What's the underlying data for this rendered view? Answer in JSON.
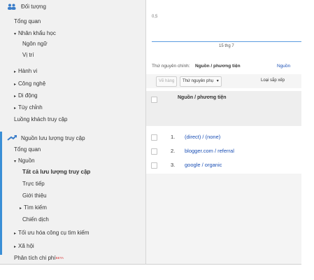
{
  "sidebar": {
    "sections": [
      {
        "label": "Đối tượng",
        "icon": "users-icon"
      },
      {
        "label": "Nguồn lưu lượng truy cập",
        "icon": "traffic-source-icon"
      }
    ],
    "items": [
      {
        "label": "Tổng quan"
      },
      {
        "label": "Nhân khẩu học",
        "arrow": "▾"
      },
      {
        "label": "Ngôn ngữ"
      },
      {
        "label": "Vị trí"
      },
      {
        "label": "Hành vi",
        "arrow": "▸"
      },
      {
        "label": "Công nghệ",
        "arrow": "▸"
      },
      {
        "label": "Di động",
        "arrow": "▸"
      },
      {
        "label": "Tùy chỉnh",
        "arrow": "▸"
      },
      {
        "label": "Luồng khách truy cập"
      },
      {
        "label": "Tổng quan"
      },
      {
        "label": "Nguồn",
        "arrow": "▾"
      },
      {
        "label": "Tất cả lưu lượng truy cập"
      },
      {
        "label": "Trực tiếp"
      },
      {
        "label": "Giới thiệu"
      },
      {
        "label": "Tìm kiếm",
        "arrow": "▸"
      },
      {
        "label": "Chiến dịch"
      },
      {
        "label": "Tối ưu hóa công cụ tìm kiếm",
        "arrow": "▸"
      },
      {
        "label": "Xã hội",
        "arrow": "▸"
      },
      {
        "label": "Phân tích chi phí",
        "badge": "BETA"
      }
    ]
  },
  "chart": {
    "y_tick": "0,5",
    "x_tick": "15 thg 7"
  },
  "dimension": {
    "prefix": "Thứ nguyên chính:",
    "active": "Nguồn / phương tiện",
    "other": "Nguồn"
  },
  "toolbar": {
    "plot_rows": "Vẽ hàng",
    "secondary": "Thứ nguyên phụ",
    "caret": "▾",
    "sort": "Loại sắp xếp"
  },
  "table": {
    "header": "Nguồn / phương tiện",
    "rows": [
      {
        "num": "1.",
        "source": "(direct) / (none)"
      },
      {
        "num": "2.",
        "source": "blogger.com / referral"
      },
      {
        "num": "3.",
        "source": "google / organic"
      }
    ]
  },
  "colors": {
    "accent": "#3a8fd6",
    "link": "#1a4fb5",
    "beta": "#d93b3b"
  }
}
